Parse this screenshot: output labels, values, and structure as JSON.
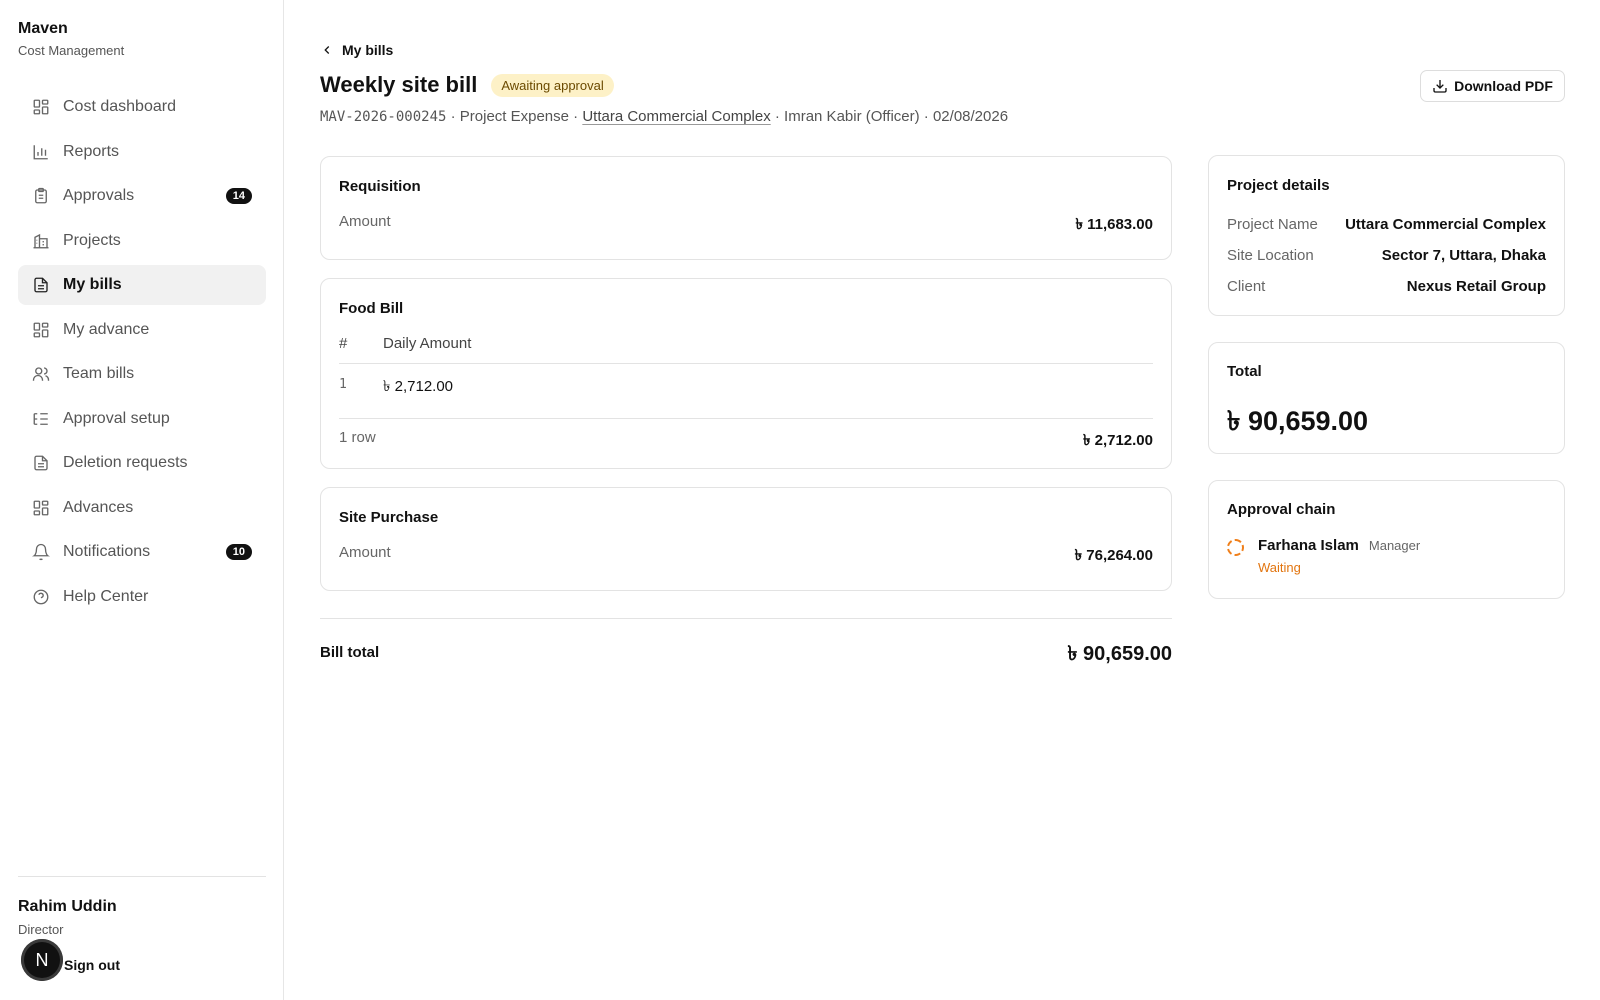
{
  "brand": {
    "name": "Maven",
    "subtitle": "Cost Management"
  },
  "nav": [
    {
      "label": "Cost dashboard",
      "icon": "dashboard-icon",
      "badge": ""
    },
    {
      "label": "Reports",
      "icon": "bar-chart-icon",
      "badge": ""
    },
    {
      "label": "Approvals",
      "icon": "clipboard-icon",
      "badge": "14"
    },
    {
      "label": "Projects",
      "icon": "building-icon",
      "badge": ""
    },
    {
      "label": "My bills",
      "icon": "document-icon",
      "badge": "",
      "active": true
    },
    {
      "label": "My advance",
      "icon": "dashboard-icon",
      "badge": ""
    },
    {
      "label": "Team bills",
      "icon": "users-icon",
      "badge": ""
    },
    {
      "label": "Approval setup",
      "icon": "list-tree-icon",
      "badge": ""
    },
    {
      "label": "Deletion requests",
      "icon": "document-icon",
      "badge": ""
    },
    {
      "label": "Advances",
      "icon": "dashboard-icon",
      "badge": ""
    },
    {
      "label": "Notifications",
      "icon": "bell-icon",
      "badge": "10"
    },
    {
      "label": "Help Center",
      "icon": "help-circle-icon",
      "badge": ""
    }
  ],
  "user": {
    "name": "Rahim Uddin",
    "role": "Director",
    "signout_label": "Sign out",
    "avatar_letter": "N"
  },
  "header": {
    "back_label": "My bills",
    "title": "Weekly site bill",
    "status": "Awaiting approval",
    "bill_id": "MAV-2026-000245",
    "sep1": " · Project Expense · ",
    "project_link": "Uttara Commercial Complex",
    "sep2": " · Imran Kabir (Officer) · 02/08/2026",
    "download_label": "Download PDF"
  },
  "requisition": {
    "title": "Requisition",
    "amount_label": "Amount",
    "amount": "৳ 11,683.00"
  },
  "food_bill": {
    "title": "Food Bill",
    "col_index": "#",
    "col_amount": "Daily Amount",
    "rows": [
      {
        "index": "1",
        "amount": "৳ 2,712.00"
      }
    ],
    "row_count": "1 row",
    "subtotal": "৳ 2,712.00"
  },
  "site_purchase": {
    "title": "Site Purchase",
    "amount_label": "Amount",
    "amount": "৳ 76,264.00"
  },
  "bill_total": {
    "label": "Bill total",
    "value": "৳ 90,659.00"
  },
  "project_details": {
    "title": "Project details",
    "rows": [
      {
        "key": "Project Name",
        "value": "Uttara Commercial Complex"
      },
      {
        "key": "Site Location",
        "value": "Sector 7, Uttara, Dhaka"
      },
      {
        "key": "Client",
        "value": "Nexus Retail Group"
      }
    ]
  },
  "total": {
    "title": "Total",
    "value": "৳ 90,659.00"
  },
  "approval_chain": {
    "title": "Approval chain",
    "approver": {
      "name": "Farhana Islam",
      "role": "Manager",
      "status": "Waiting"
    }
  },
  "colors": {
    "accent": "#111111",
    "status_badge_bg": "#fdf1c7",
    "waiting": "#e27510"
  }
}
